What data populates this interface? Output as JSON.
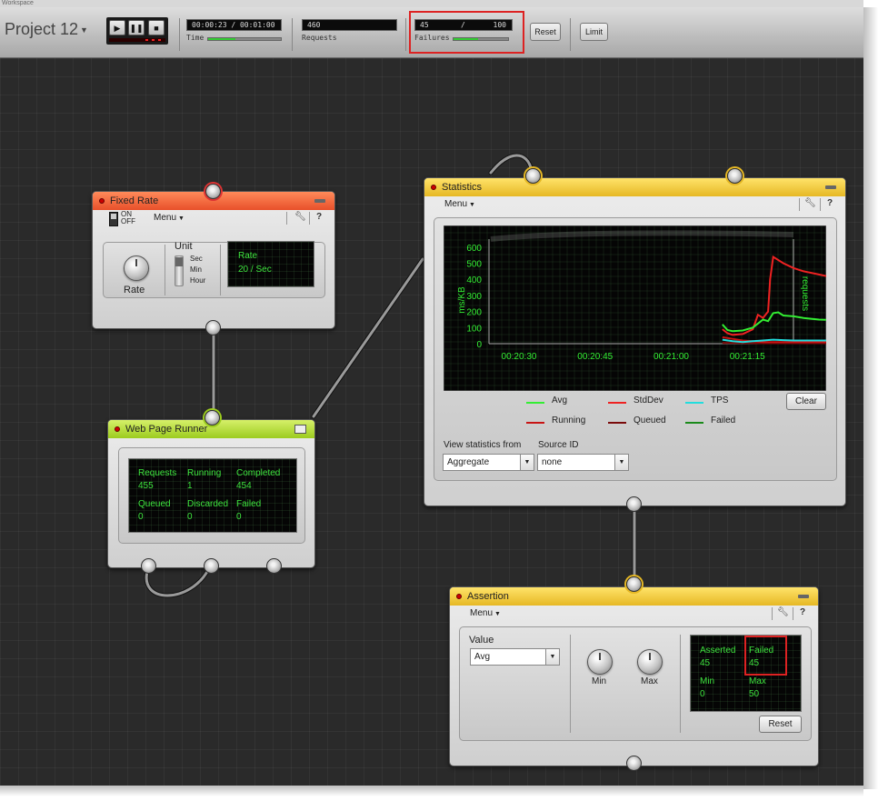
{
  "window": {
    "title": "Workspace"
  },
  "toolbar": {
    "project_title": "Project 12",
    "time": {
      "value": "00:00:23 / 00:01:00",
      "label": "Time",
      "progress": 0.38
    },
    "requests": {
      "value": "460",
      "label": "Requests"
    },
    "failures": {
      "value_left": "45",
      "value_sep": "/",
      "value_right": "100",
      "label": "Failures",
      "progress": 0.45
    },
    "reset_label": "Reset",
    "limit_label": "Limit"
  },
  "fixed_rate": {
    "title": "Fixed Rate",
    "menu_label": "Menu",
    "toggle_on": "ON",
    "toggle_off": "OFF",
    "knob_label": "Rate",
    "unit_label": "Unit",
    "unit_options": [
      "Sec",
      "Min",
      "Hour"
    ],
    "display_title": "Rate",
    "display_value": "20 / Sec"
  },
  "web_page_runner": {
    "title": "Web Page Runner",
    "stats": {
      "requests_label": "Requests",
      "requests_value": "455",
      "running_label": "Running",
      "running_value": "1",
      "completed_label": "Completed",
      "completed_value": "454",
      "queued_label": "Queued",
      "queued_value": "0",
      "discarded_label": "Discarded",
      "discarded_value": "0",
      "failed_label": "Failed",
      "failed_value": "0"
    }
  },
  "statistics": {
    "title": "Statistics",
    "menu_label": "Menu",
    "legend": [
      {
        "label": "Avg",
        "color": "#33ee33"
      },
      {
        "label": "StdDev",
        "color": "#ee2222"
      },
      {
        "label": "TPS",
        "color": "#22dddd"
      },
      {
        "label": "Running",
        "color": "#c81414"
      },
      {
        "label": "Queued",
        "color": "#7a0a0a"
      },
      {
        "label": "Failed",
        "color": "#1a8a1a"
      }
    ],
    "clear_label": "Clear",
    "view_from_label": "View statistics from",
    "view_from_value": "Aggregate",
    "source_id_label": "Source ID",
    "source_id_value": "none"
  },
  "assertion": {
    "title": "Assertion",
    "menu_label": "Menu",
    "value_label": "Value",
    "value_selected": "Avg",
    "min_label": "Min",
    "max_label": "Max",
    "display": {
      "asserted_label": "Asserted",
      "asserted_value": "45",
      "failed_label": "Failed",
      "failed_value": "45",
      "min_label": "Min",
      "min_value": "0",
      "max_label": "Max",
      "max_value": "50"
    },
    "reset_label": "Reset"
  },
  "chart_data": {
    "type": "line",
    "title": "",
    "xlabel": "",
    "ylabel": "ms/KB",
    "y2label": "requests",
    "x_ticks": [
      "00:20:30",
      "00:20:45",
      "00:21:00",
      "00:21:15"
    ],
    "y_ticks": [
      0,
      100,
      200,
      300,
      400,
      500,
      600
    ],
    "ylim": [
      0,
      650
    ],
    "xlim": [
      0,
      60
    ],
    "grid": false,
    "series": [
      {
        "name": "Avg",
        "color": "#33ee33",
        "x": [
          46,
          47,
          48,
          50,
          52,
          54,
          55,
          56,
          57,
          58,
          60,
          62,
          65,
          70,
          74
        ],
        "y": [
          120,
          85,
          78,
          82,
          100,
          150,
          140,
          190,
          195,
          175,
          170,
          160,
          150,
          145,
          140
        ]
      },
      {
        "name": "StdDev",
        "color": "#ee2222",
        "x": [
          46,
          47,
          48,
          50,
          52,
          53,
          54,
          55,
          55.4,
          56,
          58,
          60,
          62,
          65,
          68,
          72,
          74
        ],
        "y": [
          90,
          65,
          55,
          60,
          90,
          180,
          160,
          200,
          400,
          540,
          500,
          470,
          450,
          430,
          410,
          385,
          370
        ]
      },
      {
        "name": "TPS",
        "color": "#22dddd",
        "x": [
          46,
          48,
          50,
          52,
          54,
          56,
          58,
          60,
          65,
          70,
          74
        ],
        "y": [
          25,
          15,
          10,
          15,
          20,
          25,
          22,
          20,
          20,
          20,
          20
        ]
      },
      {
        "name": "Running",
        "color": "#c81414",
        "x": [
          46,
          48,
          50,
          52,
          54,
          56,
          60,
          65,
          70,
          74
        ],
        "y": [
          40,
          30,
          20,
          15,
          10,
          10,
          10,
          10,
          10,
          10
        ]
      },
      {
        "name": "Queued",
        "color": "#7a0a0a",
        "x": [
          46,
          50,
          54,
          58,
          62,
          66,
          70,
          74
        ],
        "y": [
          5,
          4,
          3,
          3,
          3,
          3,
          3,
          3
        ]
      }
    ]
  }
}
